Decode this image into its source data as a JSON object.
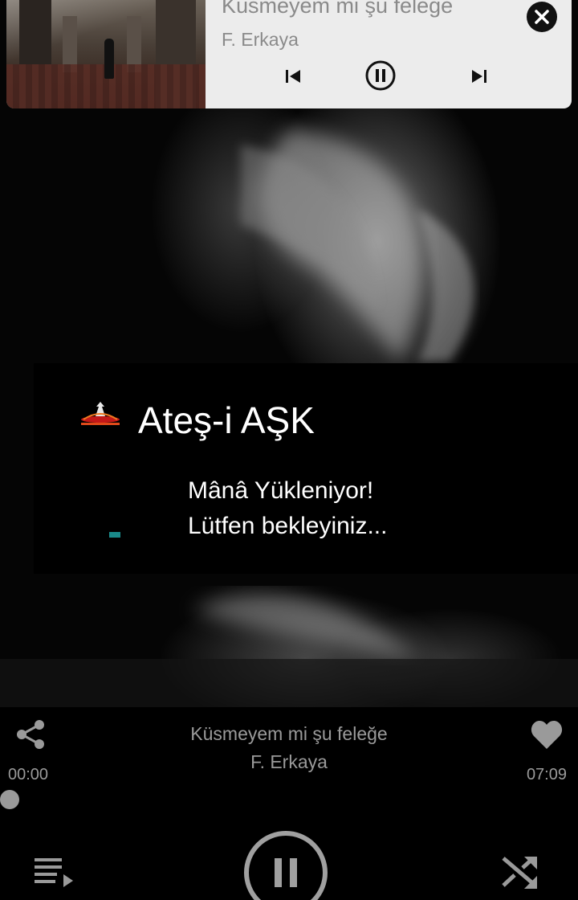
{
  "notification": {
    "title": "Küsmeyem mi şu feleğe",
    "artist": "F. Erkaya",
    "icons": [
      "close-icon",
      "previous-icon",
      "pause-icon",
      "next-icon"
    ]
  },
  "card": {
    "title": "Ateş-i AŞK",
    "message_line1": "Mânâ Yükleniyor!",
    "message_line2": "Lütfen bekleyiniz..."
  },
  "player": {
    "title": "Küsmeyem mi şu feleğe",
    "artist": "F. Erkaya",
    "current_time": "00:00",
    "total_time": "07:09",
    "progress": 0,
    "icons": [
      "share-icon",
      "heart-icon",
      "playlist-icon",
      "pause-icon",
      "shuffle-icon"
    ]
  },
  "colors": {
    "accent": "#1a8a8a",
    "notification_bg": "#ececec",
    "muted_text": "#9a9a9a"
  }
}
